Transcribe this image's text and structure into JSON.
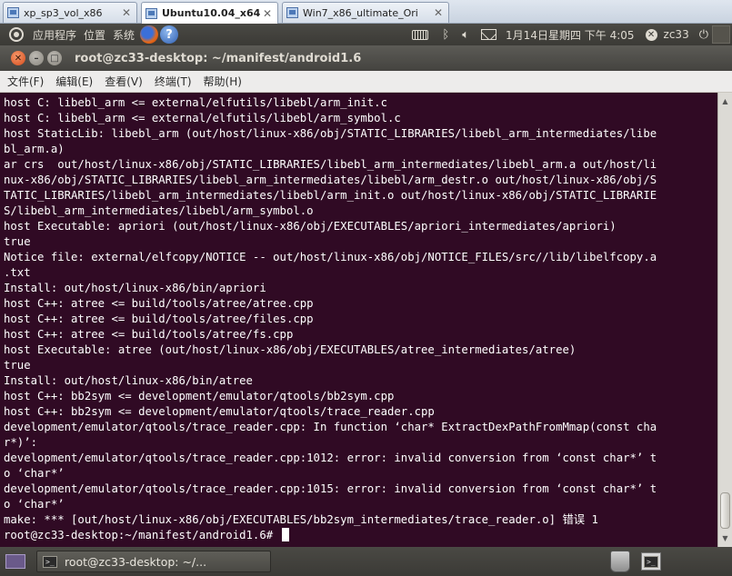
{
  "vm_tabs": [
    {
      "label": "xp_sp3_vol_x86",
      "active": false
    },
    {
      "label": "Ubuntu10.04_x64",
      "active": true
    },
    {
      "label": "Win7_x86_ultimate_Ori",
      "active": false
    }
  ],
  "top_panel": {
    "applications": "应用程序",
    "places": "位置",
    "system": "系统",
    "help_glyph": "?",
    "datetime": "1月14日星期四 下午 4:05",
    "username": "zc33"
  },
  "terminal": {
    "title": "root@zc33-desktop: ~/manifest/android1.6",
    "menu": [
      "文件(F)",
      "编辑(E)",
      "查看(V)",
      "终端(T)",
      "帮助(H)"
    ],
    "lines": [
      "host C: libebl_arm <= external/elfutils/libebl/arm_init.c",
      "host C: libebl_arm <= external/elfutils/libebl/arm_symbol.c",
      "host StaticLib: libebl_arm (out/host/linux-x86/obj/STATIC_LIBRARIES/libebl_arm_intermediates/libe",
      "bl_arm.a)",
      "ar crs  out/host/linux-x86/obj/STATIC_LIBRARIES/libebl_arm_intermediates/libebl_arm.a out/host/li",
      "nux-x86/obj/STATIC_LIBRARIES/libebl_arm_intermediates/libebl/arm_destr.o out/host/linux-x86/obj/S",
      "TATIC_LIBRARIES/libebl_arm_intermediates/libebl/arm_init.o out/host/linux-x86/obj/STATIC_LIBRARIE",
      "S/libebl_arm_intermediates/libebl/arm_symbol.o",
      "host Executable: apriori (out/host/linux-x86/obj/EXECUTABLES/apriori_intermediates/apriori)",
      "true",
      "Notice file: external/elfcopy/NOTICE -- out/host/linux-x86/obj/NOTICE_FILES/src//lib/libelfcopy.a",
      ".txt",
      "Install: out/host/linux-x86/bin/apriori",
      "host C++: atree <= build/tools/atree/atree.cpp",
      "host C++: atree <= build/tools/atree/files.cpp",
      "host C++: atree <= build/tools/atree/fs.cpp",
      "host Executable: atree (out/host/linux-x86/obj/EXECUTABLES/atree_intermediates/atree)",
      "true",
      "Install: out/host/linux-x86/bin/atree",
      "host C++: bb2sym <= development/emulator/qtools/bb2sym.cpp",
      "host C++: bb2sym <= development/emulator/qtools/trace_reader.cpp",
      "development/emulator/qtools/trace_reader.cpp: In function ‘char* ExtractDexPathFromMmap(const cha",
      "r*)’:",
      "development/emulator/qtools/trace_reader.cpp:1012: error: invalid conversion from ‘const char*’ t",
      "o ‘char*’",
      "development/emulator/qtools/trace_reader.cpp:1015: error: invalid conversion from ‘const char*’ t",
      "o ‘char*’",
      "make: *** [out/host/linux-x86/obj/EXECUTABLES/bb2sym_intermediates/trace_reader.o] 错误 1"
    ],
    "prompt": "root@zc33-desktop:~/manifest/android1.6# "
  },
  "bottom_panel": {
    "task_label": "root@zc33-desktop: ~/..."
  },
  "colors": {
    "terminal_bg": "#300a24",
    "terminal_fg": "#ffffff",
    "panel_bg": "#3c3b37"
  }
}
